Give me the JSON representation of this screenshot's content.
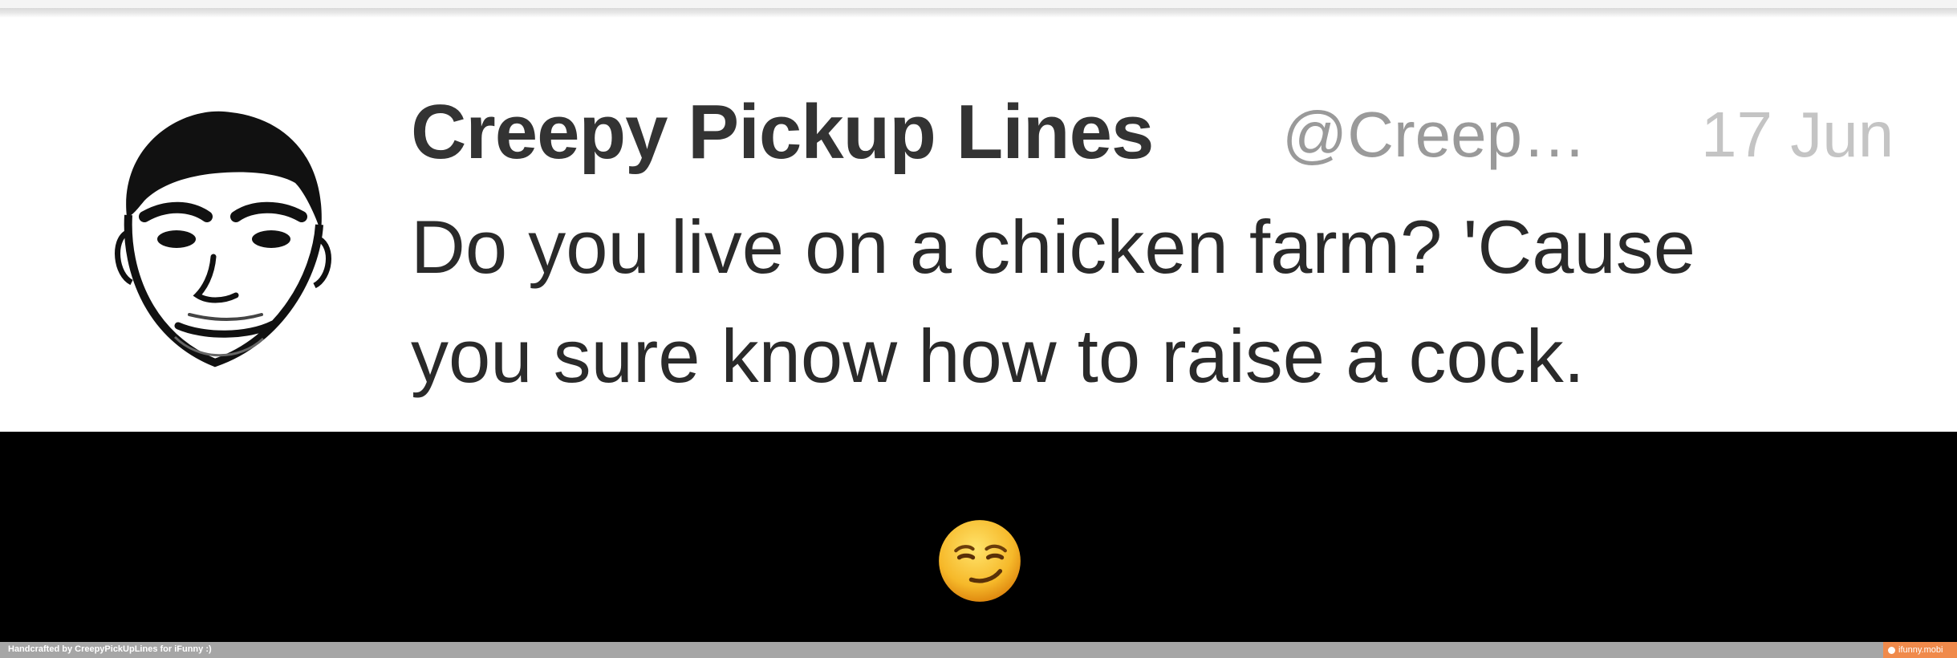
{
  "tweet": {
    "display_name": "Creepy Pickup Lines",
    "handle": "@Creep…",
    "timestamp": "17 Jun",
    "text_line1": "Do you live on a chicken farm? 'Cause",
    "text_line2": "you sure know how to raise a cock.",
    "avatar_icon": "creepy-face-avatar"
  },
  "reply": {
    "emoji_icon": "smirking-face-emoji"
  },
  "footer": {
    "credit": "Handcrafted by CreepyPickUpLines for iFunny :)",
    "brand": "ifunny.mobi",
    "brand_color": "#f08a4b"
  },
  "colors": {
    "name": "#333333",
    "handle": "#9a9a9a",
    "timestamp": "#c4c4c4",
    "reply_background": "#000000"
  }
}
